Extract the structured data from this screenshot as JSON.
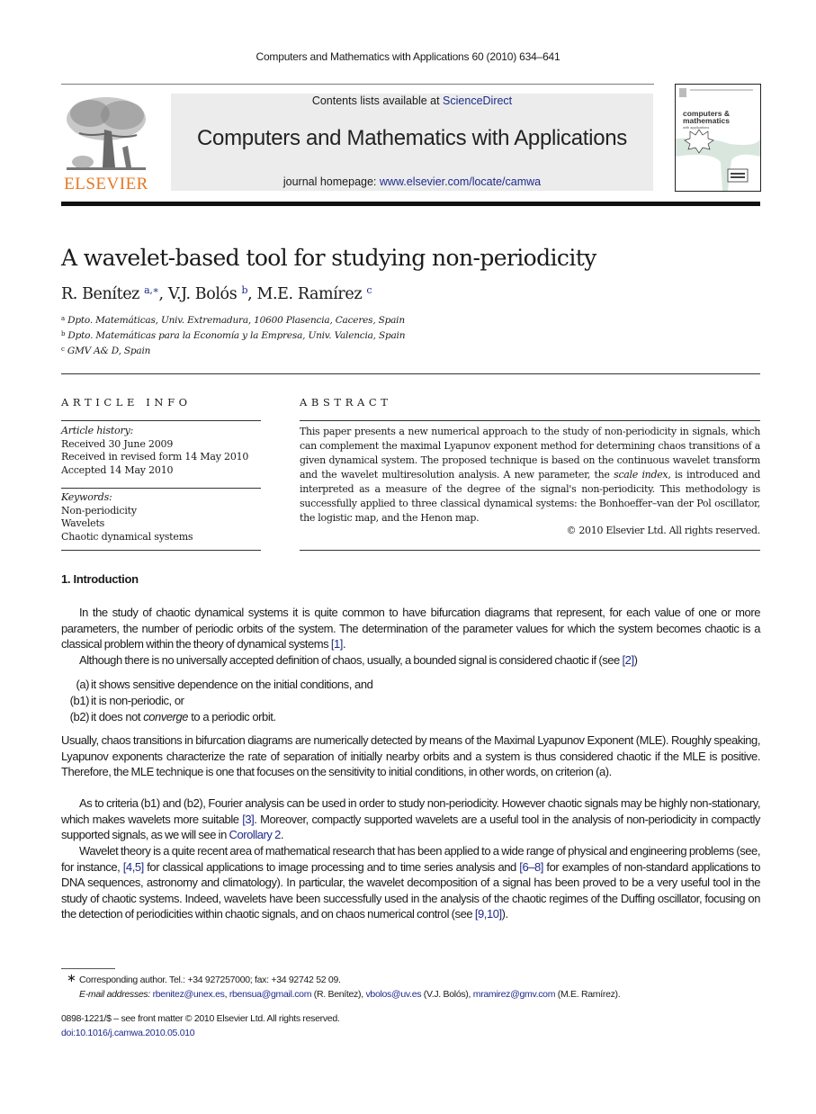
{
  "running_head": "Computers and Mathematics with Applications 60 (2010) 634–641",
  "masthead": {
    "publisher_logo_text": "ELSEVIER",
    "contents_prefix": "Contents lists available at ",
    "contents_link": "ScienceDirect",
    "journal_name": "Computers and Mathematics with Applications",
    "homepage_prefix": "journal homepage: ",
    "homepage_link": "www.elsevier.com/locate/camwa",
    "cover": {
      "line1": "computers &",
      "line2": "mathematics",
      "line3": "with applications"
    }
  },
  "article": {
    "title": "A wavelet-based tool for studying non-periodicity",
    "authors": [
      {
        "name": "R. Benítez",
        "sup": "a,∗"
      },
      {
        "name": "V.J. Bolós",
        "sup": "b"
      },
      {
        "name": "M.E. Ramírez",
        "sup": "c"
      }
    ],
    "author_separator": ", ",
    "affiliations": [
      {
        "mark": "a",
        "text": "Dpto. Matemáticas, Univ. Extremadura, 10600 Plasencia, Caceres, Spain"
      },
      {
        "mark": "b",
        "text": "Dpto. Matemáticas para la Economía y la Empresa, Univ. Valencia, Spain"
      },
      {
        "mark": "c",
        "text": "GMV A& D, Spain"
      }
    ]
  },
  "article_info": {
    "heading": "ARTICLE INFO",
    "history_label": "Article history:",
    "history": [
      "Received 30 June 2009",
      "Received in revised form 14 May 2010",
      "Accepted 14 May 2010"
    ],
    "keywords_label": "Keywords:",
    "keywords": [
      "Non-periodicity",
      "Wavelets",
      "Chaotic dynamical systems"
    ]
  },
  "abstract": {
    "heading": "ABSTRACT",
    "text_before_italic": "This paper presents a new numerical approach to the study of non-periodicity in signals, which can complement the maximal Lyapunov exponent method for determining chaos transitions of a given dynamical system. The proposed technique is based on the continuous wavelet transform and the wavelet multiresolution analysis. A new parameter, the ",
    "italic_term": "scale index",
    "text_after_italic": ", is introduced and interpreted as a measure of the degree of the signal's non-periodicity. This methodology is successfully applied to three classical dynamical systems: the Bonhoeffer–van der Pol oscillator, the logistic map, and the Henon map.",
    "copyright": "© 2010 Elsevier Ltd. All rights reserved."
  },
  "introduction": {
    "heading": "1.  Introduction",
    "p1_text": "In the study of chaotic dynamical systems it is quite common to have bifurcation diagrams that represent, for each value of one or more parameters, the number of periodic orbits of the system. The determination of the parameter values for which the system becomes chaotic is a classical problem within the theory of dynamical systems ",
    "p1_ref": "[1]",
    "p1_end": ".",
    "p2_text": "Although there is no universally accepted definition of chaos, usually, a bounded signal is considered chaotic if (see ",
    "p2_ref": "[2]",
    "p2_end": ")",
    "criteria": [
      {
        "label": "(a)",
        "text": "it shows sensitive dependence on the initial conditions, and"
      },
      {
        "label": "(b1)",
        "text": "it is non-periodic, or"
      },
      {
        "label": "(b2)",
        "text_before": "it does not ",
        "italic": "converge",
        "text_after": " to a periodic orbit."
      }
    ],
    "p3_text": "Usually, chaos transitions in bifurcation diagrams are numerically detected by means of the Maximal Lyapunov Exponent (MLE). Roughly speaking, Lyapunov exponents characterize the rate of separation of initially nearby orbits and a system is thus considered chaotic if the MLE is positive. Therefore, the MLE technique is one that focuses on the sensitivity to initial conditions, in other words, on criterion (a).",
    "p4_text": "As to criteria (b1) and (b2), Fourier analysis can be used in order to study non-periodicity. However chaotic signals may be highly non-stationary, which makes wavelets more suitable ",
    "p4_ref": "[3]",
    "p4_mid": ". Moreover, compactly supported wavelets are a useful tool in the analysis of non-periodicity in compactly supported signals, as we will see in ",
    "p4_link": "Corollary 2",
    "p4_end": ".",
    "p5_a": "Wavelet theory is a quite recent area of mathematical research that has been applied to a wide range of physical and engineering problems (see, for instance, ",
    "p5_ref1": "[4,5]",
    "p5_b": " for classical applications to image processing and to time series analysis and ",
    "p5_ref2": "[6–8]",
    "p5_c": " for examples of non-standard applications to DNA sequences, astronomy and climatology). In particular, the wavelet decomposition of a signal has been proved to be a very useful tool in the study of chaotic systems. Indeed, wavelets have been successfully used in the analysis of the chaotic regimes of the Duffing oscillator, focusing on the detection of periodicities within chaotic signals, and on chaos numerical control (see ",
    "p5_ref3": "[9,10]",
    "p5_d": ")."
  },
  "footnotes": {
    "star": "∗",
    "corresponding": "Corresponding author. Tel.: +34 927257000; fax: +34 92742 52 09.",
    "email_label": "E-mail addresses: ",
    "emails": [
      {
        "address": "rbenitez@unex.es",
        "suffix": ", "
      },
      {
        "address": "rbensua@gmail.com",
        "suffix": " (R. Benítez), "
      },
      {
        "address": "vbolos@uv.es",
        "suffix": " (V.J. Bolós), "
      },
      {
        "address": "mramirez@gmv.com",
        "suffix": " (M.E. Ramírez)."
      }
    ],
    "issn_line": "0898-1221/$ – see front matter © 2010 Elsevier Ltd. All rights reserved.",
    "doi": "doi:10.1016/j.camwa.2010.05.010"
  }
}
